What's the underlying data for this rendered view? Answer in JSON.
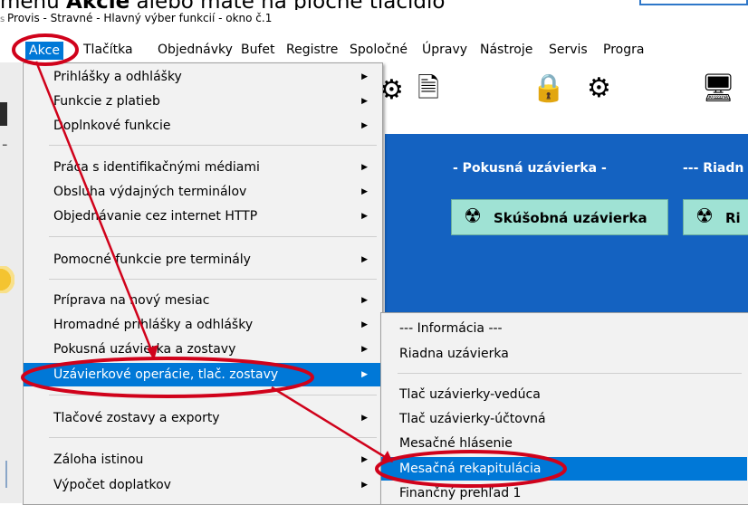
{
  "caption": {
    "pre": "menu ",
    "bold": "Akcie",
    "post": " alebo máte na ploche tlačidlo"
  },
  "window": {
    "title": "Provis - Stravné - Hlavný výber funkcií - okno č.1"
  },
  "menubar": {
    "items": [
      "Akce",
      "Tlačítka",
      "Objednávky",
      "Bufet",
      "Registre",
      "Spoločné",
      "Úpravy",
      "Nástroje",
      "Servis",
      "Progra"
    ],
    "active_index": 0
  },
  "main_menu": {
    "items": [
      {
        "label": "Prihlášky a odhlášky",
        "submenu": true
      },
      {
        "label": "Funkcie z platieb",
        "submenu": true
      },
      {
        "label": "Doplnkové funkcie",
        "submenu": true
      },
      {
        "label": "Práca s identifikačnými médiami",
        "submenu": true
      },
      {
        "label": "Obsluha výdajných terminálov",
        "submenu": true
      },
      {
        "label": "Objednávanie cez internet HTTP",
        "submenu": true
      },
      {
        "label": "Pomocné funkcie pre terminály",
        "submenu": true
      },
      {
        "label": "Príprava na nový mesiac",
        "submenu": true
      },
      {
        "label": "Hromadné prihlášky a odhlášky",
        "submenu": true
      },
      {
        "label": "Pokusná uzávierka a zostavy",
        "submenu": true
      },
      {
        "label": "Uzávierkové operácie, tlač. zostavy",
        "submenu": true,
        "highlighted": true
      },
      {
        "label": "Tlačové zostavy a exporty",
        "submenu": true
      },
      {
        "label": "Záloha istinou",
        "submenu": true
      },
      {
        "label": "Výpočet doplatkov",
        "submenu": true
      }
    ]
  },
  "sub_menu": {
    "items": [
      {
        "label": "--- Informácia ---"
      },
      {
        "label": "Riadna uzávierka"
      },
      {
        "label": "Tlač uzávierky-vedúca"
      },
      {
        "label": "Tlač uzávierky-účtovná"
      },
      {
        "label": "Mesačné hlásenie"
      },
      {
        "label": "Mesačná rekapitulácia",
        "highlighted": true
      },
      {
        "label": "Finančný prehľad 1"
      }
    ]
  },
  "panel": {
    "heading_trial": "- Pokusná uzávierka -",
    "heading_regular": "--- Riadn",
    "button_trial": "Skúšobná uzávierka",
    "button_regular": "Ri"
  },
  "icons": {
    "toolbar": [
      "tool-key-icon",
      "document-arrow-icon",
      "padlock-icon",
      "gear-icon",
      "monitor-icon"
    ],
    "menu_arrow": "chevron-right-icon"
  },
  "colors": {
    "accent": "#0078d7",
    "panel": "#1462c1",
    "panel_button": "#9fe2d4",
    "annotation": "#d0021b"
  }
}
